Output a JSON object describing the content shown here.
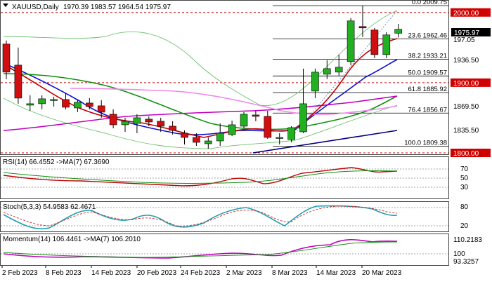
{
  "header": {
    "symbol": "XAUUSD,Daily",
    "ohlc": "1970.39 1983.57 1964.54 1975.97"
  },
  "price_axis": {
    "ticks": [
      "1969.50",
      "1936.50",
      "1869.50",
      "1835.50"
    ],
    "current_price": "1975.97",
    "hidden_partial": "197.05"
  },
  "horizontal_levels": [
    {
      "label": "2000.00",
      "value": 2000.0,
      "color": "#d00000"
    },
    {
      "label": "1900.00",
      "value": 1900.0,
      "color": "#d00000"
    },
    {
      "label": "1800.00",
      "value": 1800.0,
      "color": "#d00000"
    }
  ],
  "fibonacci": [
    {
      "label": "0.0 2009.75",
      "value": 2009.75
    },
    {
      "label": "23.6 1962.46",
      "value": 1962.46
    },
    {
      "label": "38.2 1933.21",
      "value": 1933.21
    },
    {
      "label": "50.0 1909.57",
      "value": 1909.57
    },
    {
      "label": "61.8 1885.92",
      "value": 1885.92
    },
    {
      "label": "76.4 1856.67",
      "value": 1856.67
    },
    {
      "label": "100.0 1809.38",
      "value": 1809.38
    }
  ],
  "panels": {
    "rsi": {
      "label": "RSI(14) 66.4552 ->MA(7) 67.3690",
      "ticks": [
        "70",
        "50",
        "30"
      ]
    },
    "stoch": {
      "label": "Stoch(5,3,3) 54.9583 62.4671",
      "ticks": [
        "80",
        "20"
      ]
    },
    "momentum": {
      "label": "Momentum(14) 106.4461 ->MA(7) 106.2010",
      "ticks": [
        "110.2183",
        "100",
        "93.3257"
      ]
    }
  },
  "time_axis": [
    "2 Feb 2023",
    "8 Feb 2023",
    "14 Feb 2023",
    "20 Feb 2023",
    "24 Feb 2023",
    "2 Mar 2023",
    "8 Mar 2023",
    "14 Mar 2023",
    "20 Mar 2023"
  ],
  "colors": {
    "bull": "#22b022",
    "bear": "#d01010",
    "fib": "#000000",
    "level": "#d00000",
    "ma_blue": "#1010d0",
    "ma_green": "#109010",
    "ma_magenta": "#c000c0",
    "ma_pink": "#ee88ee",
    "trend_navy": "#000080",
    "envelope": "#70c070"
  },
  "chart_data": {
    "type": "candlestick",
    "title": "XAUUSD,Daily",
    "candles": [
      {
        "o": 1955,
        "h": 1960,
        "l": 1905,
        "c": 1915
      },
      {
        "o": 1925,
        "h": 1950,
        "l": 1870,
        "c": 1878
      },
      {
        "o": 1868,
        "h": 1882,
        "l": 1860,
        "c": 1870
      },
      {
        "o": 1870,
        "h": 1882,
        "l": 1862,
        "c": 1877
      },
      {
        "o": 1876,
        "h": 1880,
        "l": 1866,
        "c": 1876
      },
      {
        "o": 1876,
        "h": 1885,
        "l": 1862,
        "c": 1865
      },
      {
        "o": 1864,
        "h": 1876,
        "l": 1858,
        "c": 1872
      },
      {
        "o": 1871,
        "h": 1878,
        "l": 1862,
        "c": 1866
      },
      {
        "o": 1867,
        "h": 1875,
        "l": 1850,
        "c": 1858
      },
      {
        "o": 1855,
        "h": 1862,
        "l": 1835,
        "c": 1840
      },
      {
        "o": 1840,
        "h": 1850,
        "l": 1830,
        "c": 1845
      },
      {
        "o": 1842,
        "h": 1855,
        "l": 1828,
        "c": 1850
      },
      {
        "o": 1848,
        "h": 1852,
        "l": 1838,
        "c": 1844
      },
      {
        "o": 1845,
        "h": 1850,
        "l": 1830,
        "c": 1838
      },
      {
        "o": 1838,
        "h": 1845,
        "l": 1826,
        "c": 1832
      },
      {
        "o": 1828,
        "h": 1832,
        "l": 1812,
        "c": 1822
      },
      {
        "o": 1822,
        "h": 1828,
        "l": 1810,
        "c": 1815
      },
      {
        "o": 1813,
        "h": 1822,
        "l": 1806,
        "c": 1817
      },
      {
        "o": 1817,
        "h": 1842,
        "l": 1810,
        "c": 1828
      },
      {
        "o": 1826,
        "h": 1846,
        "l": 1824,
        "c": 1840
      },
      {
        "o": 1838,
        "h": 1858,
        "l": 1835,
        "c": 1855
      },
      {
        "o": 1854,
        "h": 1860,
        "l": 1845,
        "c": 1852
      },
      {
        "o": 1852,
        "h": 1860,
        "l": 1820,
        "c": 1822
      },
      {
        "o": 1822,
        "h": 1828,
        "l": 1812,
        "c": 1822
      },
      {
        "o": 1819,
        "h": 1838,
        "l": 1815,
        "c": 1836
      },
      {
        "o": 1830,
        "h": 1920,
        "l": 1828,
        "c": 1870
      },
      {
        "o": 1888,
        "h": 1920,
        "l": 1878,
        "c": 1915
      },
      {
        "o": 1912,
        "h": 1932,
        "l": 1905,
        "c": 1920
      },
      {
        "o": 1915,
        "h": 1940,
        "l": 1910,
        "c": 1922
      },
      {
        "o": 1930,
        "h": 1992,
        "l": 1925,
        "c": 1988
      },
      {
        "o": 1980,
        "h": 2009.75,
        "l": 1965,
        "c": 1978
      },
      {
        "o": 1975,
        "h": 1978,
        "l": 1935,
        "c": 1940
      },
      {
        "o": 1940,
        "h": 1972,
        "l": 1935,
        "c": 1968
      },
      {
        "o": 1970.39,
        "h": 1983.57,
        "l": 1964.54,
        "c": 1975.97
      }
    ]
  }
}
